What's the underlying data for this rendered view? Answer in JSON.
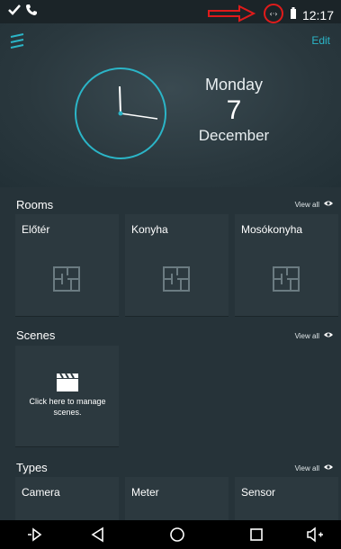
{
  "status_bar": {
    "time": "12:17",
    "icons": [
      "check-icon",
      "phone-icon",
      "arrow-annotation-icon",
      "network-activity-icon",
      "battery-icon"
    ]
  },
  "header": {
    "edit_label": "Edit"
  },
  "date": {
    "day": "Monday",
    "number": "7",
    "month": "December"
  },
  "rooms": {
    "title": "Rooms",
    "view_all": "View all",
    "items": [
      {
        "label": "Előtér",
        "icon": "floorplan-icon"
      },
      {
        "label": "Konyha",
        "icon": "floorplan-icon"
      },
      {
        "label": "Mosókonyha",
        "icon": "floorplan-icon"
      }
    ]
  },
  "scenes": {
    "title": "Scenes",
    "view_all": "View all",
    "manage_text": "Click here to manage scenes."
  },
  "types": {
    "title": "Types",
    "view_all": "View all",
    "items": [
      {
        "label": "Camera"
      },
      {
        "label": "Meter"
      },
      {
        "label": "Sensor"
      }
    ]
  },
  "colors": {
    "accent": "#2bb5c7",
    "background": "#263339",
    "tile": "#2c393f",
    "annotation": "#e01b1b"
  }
}
